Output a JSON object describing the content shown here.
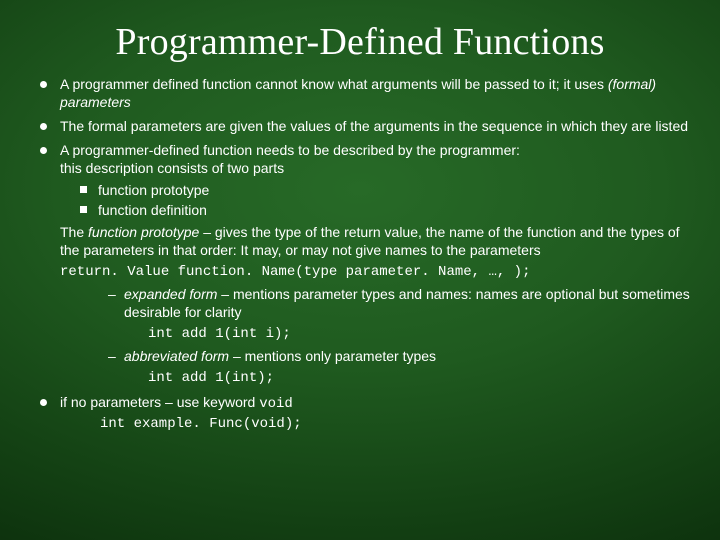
{
  "title": "Programmer-Defined Functions",
  "b1a": "A programmer defined function cannot know what arguments will be passed to it; it uses ",
  "b1b": "(formal) parameters",
  "b2": "The formal parameters are given the values of the arguments in the sequence in which they are listed",
  "b3": "A programmer-defined function needs to be described by the programmer:\nthis description consists of two parts",
  "sub1": "function prototype",
  "sub2": "function definition",
  "proto_a": "The ",
  "proto_b": "function prototype",
  "proto_c": " – gives the type of the return value, the name of the function and the types of the parameters in that order: It may, or may not give names to the parameters",
  "proto_code": "return. Value function. Name(type parameter. Name, …, );",
  "exp_a": "expanded form",
  "exp_b": " – mentions parameter types and names: names are optional but sometimes desirable for clarity",
  "exp_code": "int add 1(int i);",
  "abb_a": "abbreviated form",
  "abb_b": " – mentions only parameter types",
  "abb_code": "int add 1(int);",
  "b4a": "if no parameters – use keyword ",
  "b4b": "void",
  "b4code": "int example. Func(void);"
}
